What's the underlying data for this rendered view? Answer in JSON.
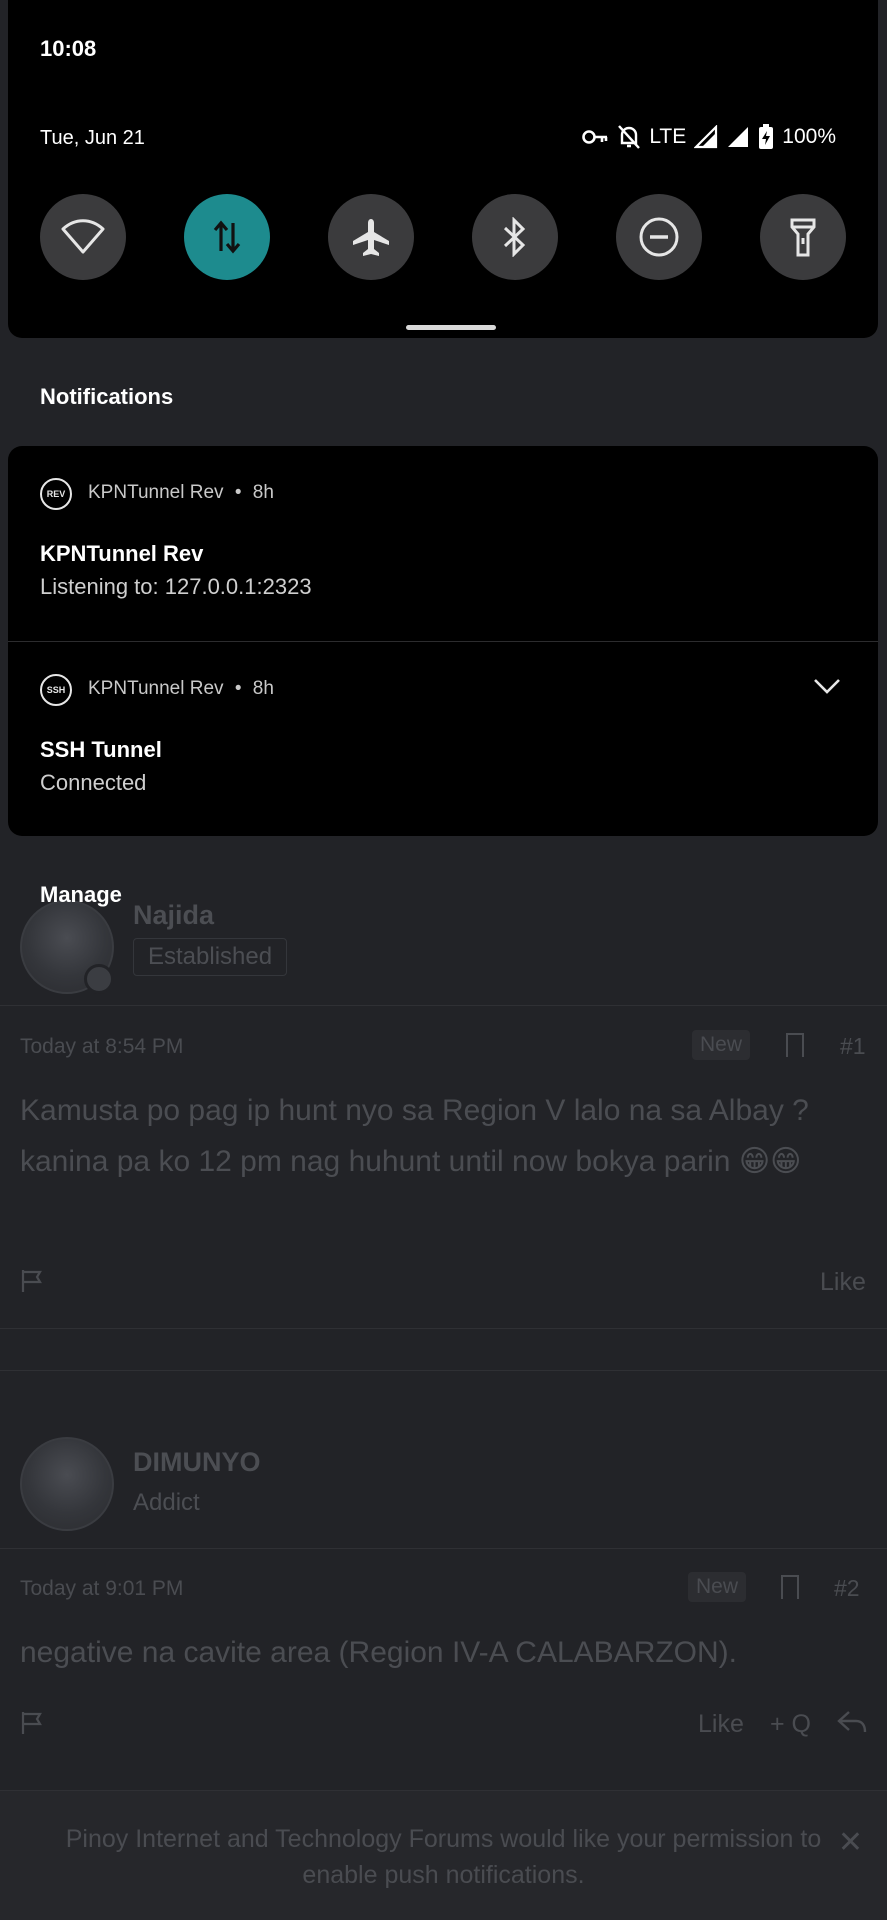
{
  "status_bar": {
    "time": "10:08",
    "date": "Tue, Jun 21",
    "network": "LTE",
    "battery": "100%",
    "icons": [
      "vpn-key-icon",
      "bell-off-icon",
      "signal-icon",
      "signal-icon",
      "battery-charging-icon"
    ]
  },
  "quick_settings": {
    "tiles": [
      {
        "name": "wifi",
        "icon": "wifi-icon",
        "active": false
      },
      {
        "name": "mobile-data",
        "icon": "mobile-data-icon",
        "active": true
      },
      {
        "name": "airplane-mode",
        "icon": "airplane-icon",
        "active": false
      },
      {
        "name": "bluetooth",
        "icon": "bluetooth-icon",
        "active": false
      },
      {
        "name": "do-not-disturb",
        "icon": "do-not-disturb-icon",
        "active": false
      },
      {
        "name": "flashlight",
        "icon": "flashlight-icon",
        "active": false
      }
    ],
    "accent_color": "#1d8b8e"
  },
  "notifications_header": "Notifications",
  "notifications": [
    {
      "app": "KPNTunnel Rev",
      "icon_text": "REV",
      "separator": "•",
      "age": "8h",
      "title": "KPNTunnel Rev",
      "text": "Listening to: 127.0.0.1:2323"
    },
    {
      "app": "KPNTunnel Rev",
      "icon_text": "SSH",
      "separator": "•",
      "age": "8h",
      "title": "SSH Tunnel",
      "text": "Connected"
    }
  ],
  "manage_label": "Manage",
  "forum": {
    "posts": [
      {
        "username": "Najida",
        "role": "Established",
        "time": "Today at 8:54 PM",
        "new_label": "New",
        "post_number": "#1",
        "body": "Kamusta po pag ip hunt nyo sa Region V lalo na sa Albay ? kanina pa ko 12 pm nag huhunt until now bokya parin 😁😁",
        "like_label": "Like"
      },
      {
        "username": "DIMUNYO",
        "role": "Addict",
        "time": "Today at 9:01 PM",
        "new_label": "New",
        "post_number": "#2",
        "body": "negative na cavite area (Region IV-A CALABARZON).",
        "like_label": "Like",
        "quote_label": "+ Q"
      }
    ],
    "push_prompt": "Pinoy Internet and Technology Forums would like your permission to enable push notifications.",
    "push_close": "✕"
  }
}
